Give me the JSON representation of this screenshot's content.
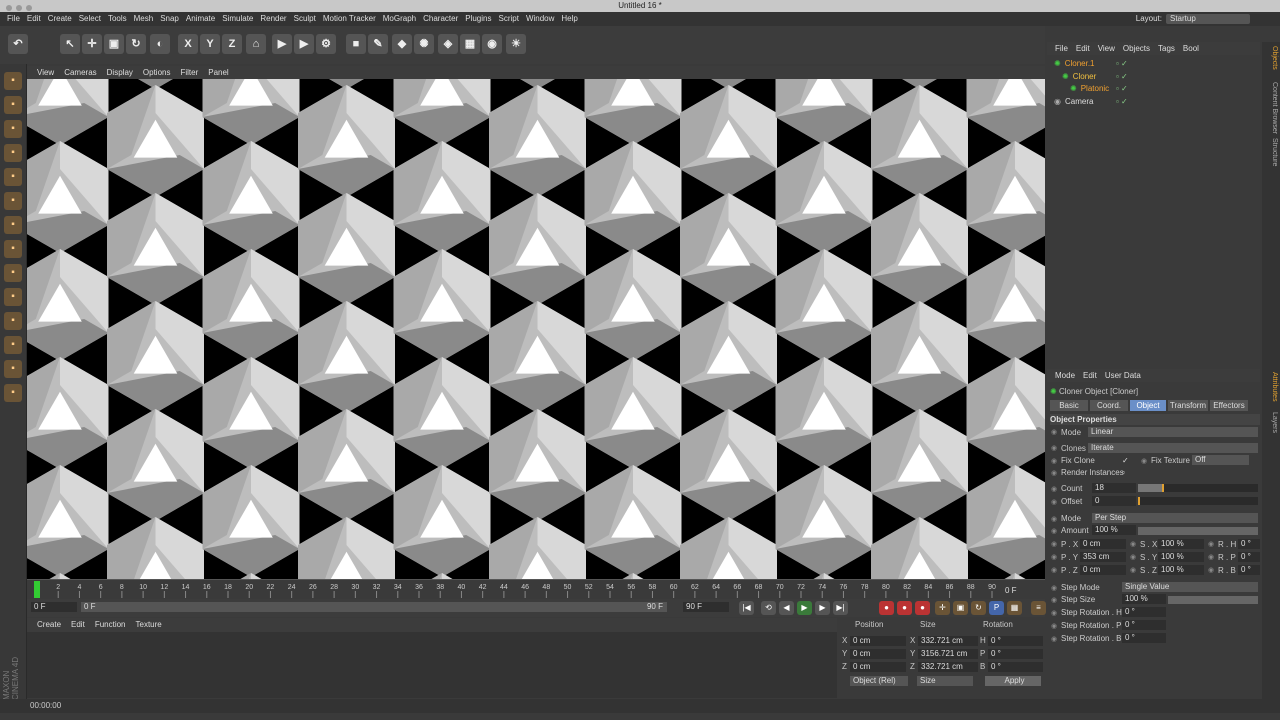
{
  "window": {
    "title": "Untitled 16 *"
  },
  "menubar": [
    "File",
    "Edit",
    "Create",
    "Select",
    "Tools",
    "Mesh",
    "Snap",
    "Animate",
    "Simulate",
    "Render",
    "Sculpt",
    "Motion Tracker",
    "MoGraph",
    "Character",
    "Plugins",
    "Script",
    "Window",
    "Help"
  ],
  "layout": {
    "label": "Layout:",
    "value": "Startup"
  },
  "viewport_menu": [
    "View",
    "Cameras",
    "Display",
    "Options",
    "Filter",
    "Panel"
  ],
  "timeline": {
    "ticks": [
      "0",
      "2",
      "4",
      "6",
      "8",
      "10",
      "12",
      "14",
      "16",
      "18",
      "20",
      "22",
      "24",
      "26",
      "28",
      "30",
      "32",
      "34",
      "36",
      "38",
      "40",
      "42",
      "44",
      "46",
      "48",
      "50",
      "52",
      "54",
      "56",
      "58",
      "60",
      "62",
      "64",
      "66",
      "68",
      "70",
      "72",
      "74",
      "76",
      "78",
      "80",
      "82",
      "84",
      "86",
      "88",
      "90"
    ],
    "current": "0 F"
  },
  "transport": {
    "start": "0 F",
    "range_end": "90 F",
    "end": "90 F",
    "slider": "0 F"
  },
  "material_menu": [
    "Create",
    "Edit",
    "Function",
    "Texture"
  ],
  "coords": {
    "headers": [
      "Position",
      "Size",
      "Rotation"
    ],
    "rows": [
      {
        "axis": "X",
        "pos": "0 cm",
        "size": "332.721 cm",
        "rot_l": "H",
        "rot": "0 °"
      },
      {
        "axis": "Y",
        "pos": "0 cm",
        "size": "3156.721 cm",
        "rot_l": "P",
        "rot": "0 °"
      },
      {
        "axis": "Z",
        "pos": "0 cm",
        "size": "332.721 cm",
        "rot_l": "B",
        "rot": "0 °"
      }
    ],
    "mode": "Object (Rel)",
    "sizemode": "Size",
    "apply": "Apply"
  },
  "status": "00:00:00",
  "objects_menu": [
    "File",
    "Edit",
    "View",
    "Objects",
    "Tags",
    "Bool"
  ],
  "objects": [
    {
      "name": "Cloner.1",
      "indent": 0,
      "color": "#f0a030"
    },
    {
      "name": "Cloner",
      "indent": 1,
      "color": "#f0c040"
    },
    {
      "name": "Platonic",
      "indent": 2,
      "color": "#f0a030"
    },
    {
      "name": "Camera",
      "indent": 0,
      "color": "#dddddd"
    }
  ],
  "attr_menu": [
    "Mode",
    "Edit",
    "User Data"
  ],
  "attr": {
    "title": "Cloner Object [Cloner]",
    "tabs": [
      "Basic",
      "Coord.",
      "Object",
      "Transform",
      "Effectors"
    ],
    "section": "Object Properties",
    "mode": "Linear",
    "clones": "Iterate",
    "fix_clone": "Fix Clone",
    "fix_texture": "Fix Texture",
    "fix_texture_val": "Off",
    "render_instances": "Render Instances",
    "count_label": "Count",
    "count": "18",
    "offset_label": "Offset",
    "offset": "0",
    "modelabel": "Mode",
    "mode2": "Per Step",
    "amount_label": "Amount",
    "amount": "100 %",
    "px": "0 cm",
    "py": "353 cm",
    "pz": "0 cm",
    "sx": "100 %",
    "sy": "100 %",
    "sz": "100 %",
    "rh": "0 °",
    "rp": "0 °",
    "rb": "0 °",
    "step_mode_label": "Step Mode",
    "step_mode": "Single Value",
    "step_size_label": "Step Size",
    "step_size": "100 %",
    "step_rh_label": "Step Rotation . H",
    "step_rh": "0 °",
    "step_rp_label": "Step Rotation . P",
    "step_rp": "0 °",
    "step_rb_label": "Step Rotation . B",
    "step_rb": "0 °"
  },
  "side_tabs": [
    "Objects",
    "Content Browser",
    "Structure",
    "Attributes",
    "Layers"
  ],
  "logo": "MAXON CINEMA 4D"
}
